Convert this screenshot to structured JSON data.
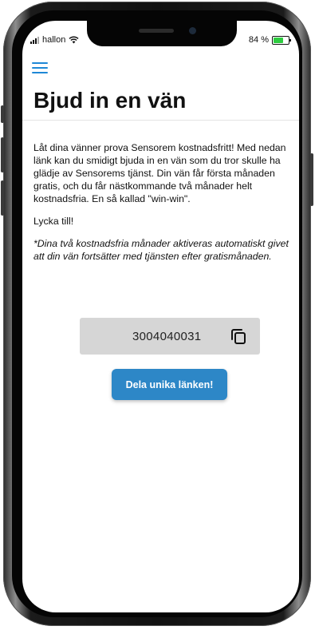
{
  "status_bar": {
    "carrier": "hallon",
    "battery_text": "84 %"
  },
  "header": {
    "menu_icon": "hamburger-menu-icon",
    "title": "Bjud in en vän"
  },
  "content": {
    "paragraph_1": "Låt dina vänner prova Sensorem kostnadsfritt! Med nedan länk kan du smidigt bjuda in en vän som du tror skulle ha glädje av Sensorems tjänst. Din vän får första månaden gratis, och du får nästkommande två månader helt kostnadsfria. En så kallad \"win-win\".",
    "paragraph_2": "Lycka till!",
    "paragraph_3": "*Dina två kostnadsfria månader aktiveras automatiskt givet att din vän fortsätter med tjänsten efter gratismånaden."
  },
  "invite": {
    "code": "3004040031",
    "copy_icon": "copy-icon",
    "share_label": "Dela unika länken!"
  },
  "colors": {
    "accent": "#2d87c7",
    "menu_icon": "#1e88d6",
    "code_box_bg": "#d6d6d6"
  }
}
